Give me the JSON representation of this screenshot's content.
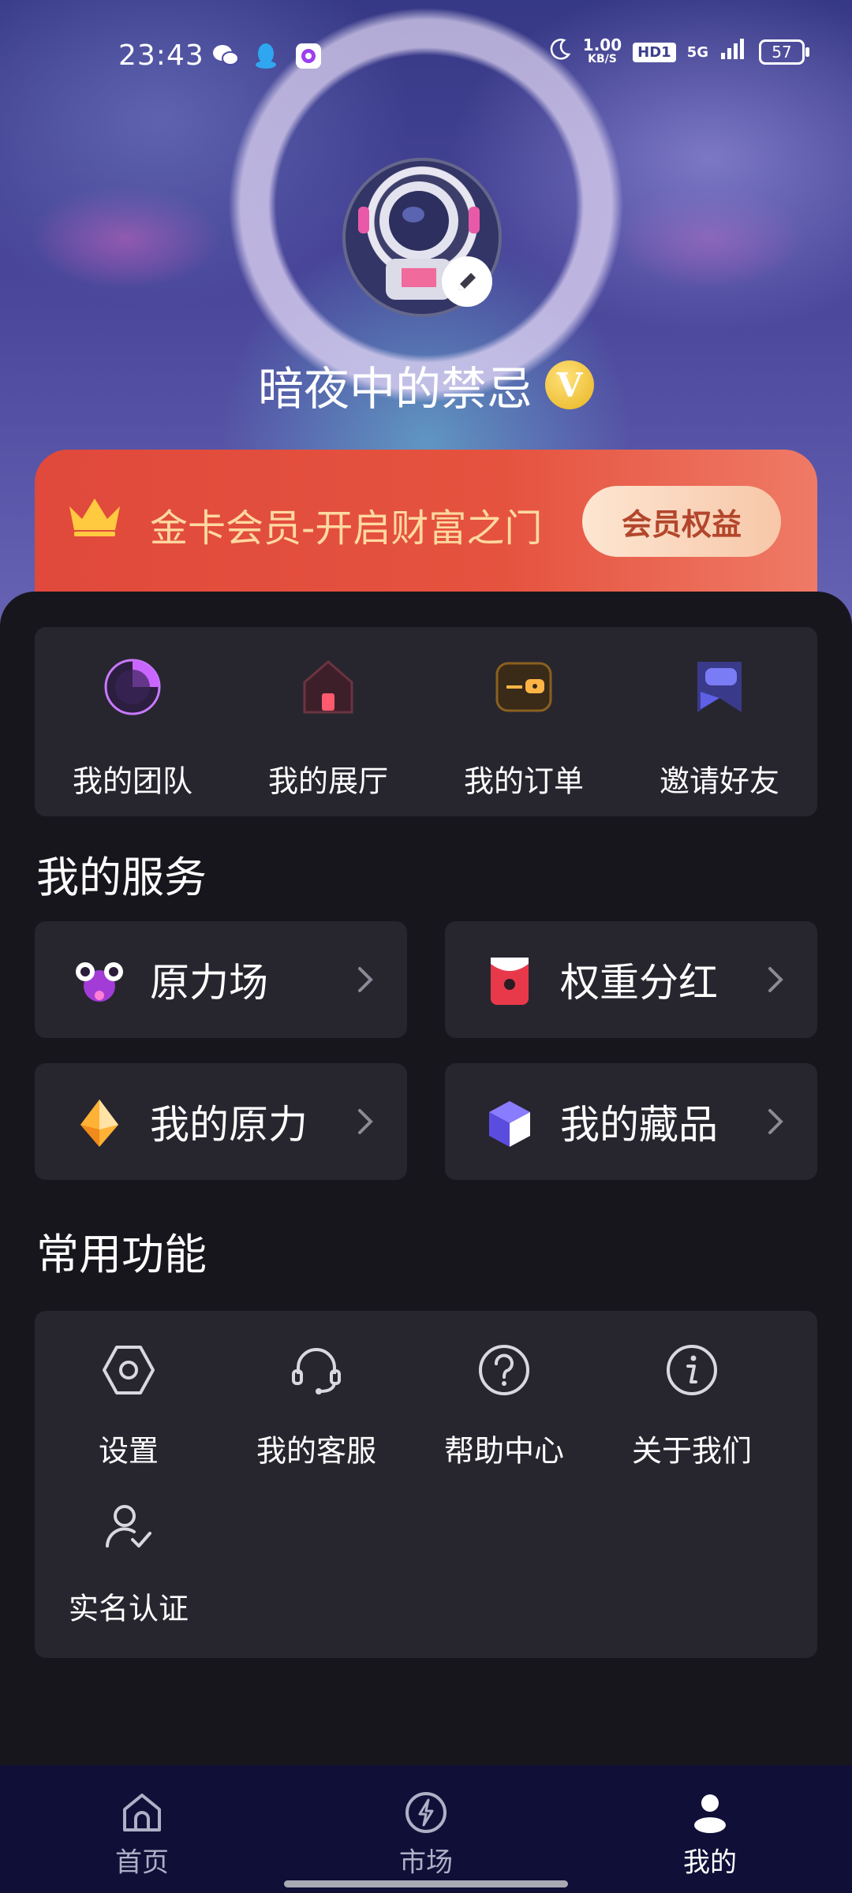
{
  "status_bar": {
    "time": "23:43",
    "speed_value": "1.00",
    "speed_unit": "KB/S",
    "hd_label": "HD1",
    "network_label": "5G",
    "battery_level": "57",
    "notification_icons": [
      "wechat-icon",
      "qq-icon",
      "app-icon"
    ]
  },
  "profile": {
    "username": "暗夜中的禁忌",
    "vip_badge": "V"
  },
  "vip_banner": {
    "title": "金卡会员-开启财富之门",
    "button_label": "会员权益"
  },
  "quick_actions": [
    {
      "label": "我的团队",
      "icon": "pie-chart-icon"
    },
    {
      "label": "我的展厅",
      "icon": "house-icon"
    },
    {
      "label": "我的订单",
      "icon": "wallet-icon"
    },
    {
      "label": "邀请好友",
      "icon": "bookmark-chat-icon"
    }
  ],
  "services": {
    "title": "我的服务",
    "items": [
      {
        "label": "原力场",
        "icon": "molecule-icon"
      },
      {
        "label": "权重分红",
        "icon": "red-envelope-icon"
      },
      {
        "label": "我的原力",
        "icon": "crystal-icon"
      },
      {
        "label": "我的藏品",
        "icon": "cube-icon"
      }
    ]
  },
  "common_functions": {
    "title": "常用功能",
    "items": [
      {
        "label": "设置",
        "icon": "hexagon-settings-icon"
      },
      {
        "label": "我的客服",
        "icon": "headset-icon"
      },
      {
        "label": "帮助中心",
        "icon": "question-icon"
      },
      {
        "label": "关于我们",
        "icon": "info-icon"
      },
      {
        "label": "实名认证",
        "icon": "user-check-icon"
      }
    ]
  },
  "tab_bar": {
    "items": [
      {
        "label": "首页",
        "icon": "home-icon"
      },
      {
        "label": "市场",
        "icon": "lightning-icon"
      },
      {
        "label": "我的",
        "icon": "user-icon"
      }
    ],
    "active": "我的"
  },
  "colors": {
    "background": "#17161c",
    "panel": "#27262f",
    "vip_red": "#e0493b",
    "vip_text": "#ffd9a0",
    "tab_bar": "#100f38"
  }
}
